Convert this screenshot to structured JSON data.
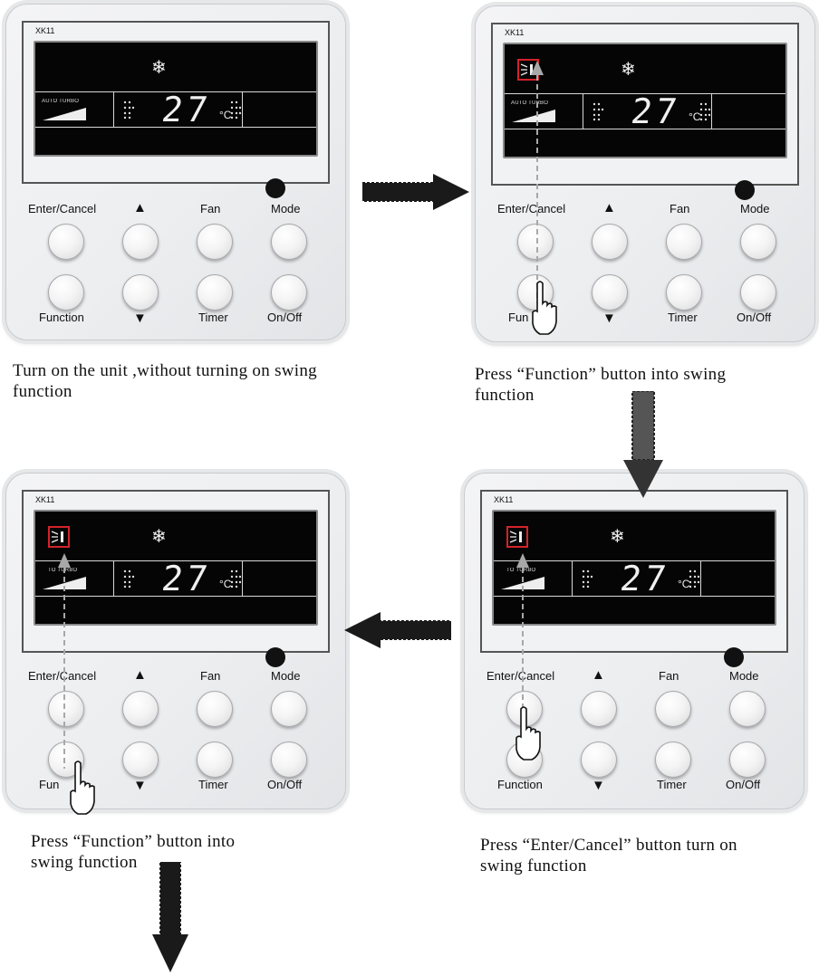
{
  "panels": [
    {
      "model": "XK11",
      "lcd": {
        "auto_turbo": "AUTO TURBO",
        "temperature": "27",
        "unit": "°C",
        "swing_icon_shown": false
      },
      "buttons": {
        "enter_cancel": "Enter/Cancel",
        "fan": "Fan",
        "mode": "Mode",
        "function": "Function",
        "timer": "Timer",
        "on_off": "On/Off"
      },
      "caption": [
        "Turn on the unit ,without turning on swing",
        "function"
      ]
    },
    {
      "model": "XK11",
      "lcd": {
        "auto_turbo": "AUTO TURBO",
        "temperature": "27",
        "unit": "°C",
        "swing_icon_shown": true
      },
      "buttons": {
        "enter_cancel": "Enter/Cancel",
        "fan": "Fan",
        "mode": "Mode",
        "function": "Fun",
        "timer": "Timer",
        "on_off": "On/Off"
      },
      "caption": [
        "Press “Function” button into swing",
        " function"
      ]
    },
    {
      "model": "XK11",
      "lcd": {
        "auto_turbo": "TO TURBO",
        "temperature": "27",
        "unit": "°C",
        "swing_icon_shown": true
      },
      "buttons": {
        "enter_cancel": "Enter/Cancel",
        "fan": "Fan",
        "mode": "Mode",
        "function": "Function",
        "timer": "Timer",
        "on_off": "On/Off"
      },
      "caption": [
        "Press “Enter/Cancel” button turn on",
        "swing function"
      ]
    },
    {
      "model": "XK11",
      "lcd": {
        "auto_turbo": "TO TURBO",
        "temperature": "27",
        "unit": "°C",
        "swing_icon_shown": true
      },
      "buttons": {
        "enter_cancel": "Enter/Cancel",
        "fan": "Fan",
        "mode": "Mode",
        "function": "Fun",
        "timer": "Timer",
        "on_off": "On/Off"
      },
      "caption": [
        "Press “Function” button into",
        "swing function"
      ]
    }
  ],
  "flow_arrows": [
    "right",
    "down",
    "left",
    "down"
  ],
  "colors": {
    "lcd_bg": "#050505",
    "highlight": "#d2232a",
    "guide": "#a8a8a8",
    "arrow": "#1a1a1a"
  },
  "icons": [
    "snowflake-icon",
    "fan-speed-ramp-icon",
    "swing-icon",
    "pointing-hand-icon",
    "up-triangle-icon",
    "down-triangle-icon"
  ]
}
